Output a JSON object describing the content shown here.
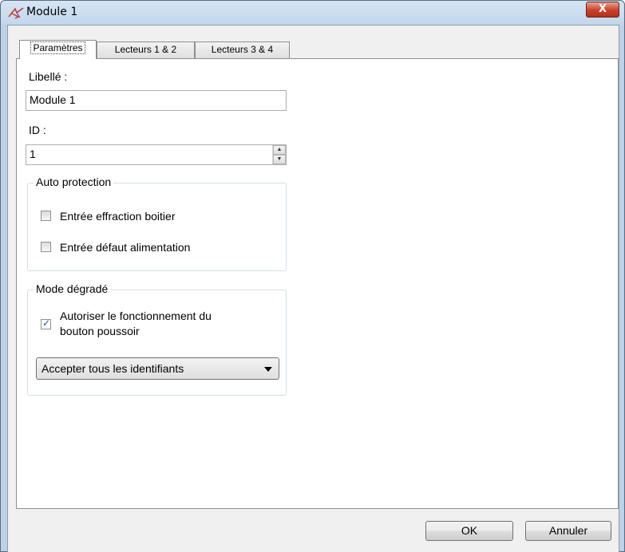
{
  "window": {
    "title": "Module 1",
    "close_glyph": "X"
  },
  "tabs": [
    {
      "label": "Paramètres",
      "active": true
    },
    {
      "label": "Lecteurs 1 & 2",
      "active": false
    },
    {
      "label": "Lecteurs 3 & 4",
      "active": false
    }
  ],
  "form": {
    "libelle_label": "Libellé :",
    "libelle_value": "Module 1",
    "id_label": "ID :",
    "id_value": "1"
  },
  "auto_protection": {
    "title": "Auto protection",
    "options": [
      {
        "label": "Entrée effraction boitier",
        "checked": false
      },
      {
        "label": "Entrée défaut alimentation",
        "checked": false
      }
    ]
  },
  "mode_degrade": {
    "title": "Mode dégradé",
    "checkbox_line1": "Autoriser le fonctionnement du",
    "checkbox_line2": "bouton poussoir",
    "checkbox_checked": true,
    "select_value": "Accepter tous les identifiants"
  },
  "buttons": {
    "ok": "OK",
    "cancel": "Annuler"
  }
}
